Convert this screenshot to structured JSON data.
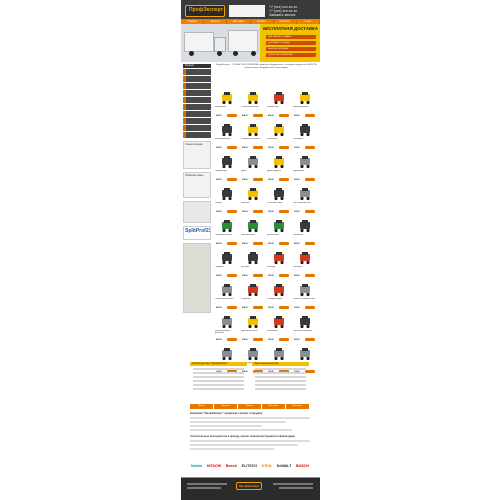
{
  "header": {
    "logo_text": "ПрофЭксперт",
    "phone_lines": [
      "+7 (xxx) xxx-xx-xx",
      "+7 (xxx) xxx-xx-xx",
      "Заказать звонок"
    ]
  },
  "nav": {
    "items": [
      "Главная",
      "Каталог",
      "Доставка",
      "Оплата",
      "Контакты",
      "О нас"
    ]
  },
  "hero": {
    "promo_title": "БЕСПЛАТНАЯ ДОСТАВКА",
    "promo_lines": [
      "при заказе от суммы",
      "доставка по городу",
      "быстрая отправка",
      "оплата при получении"
    ]
  },
  "sidebar": {
    "catalog_title": "Каталог",
    "banner_caption": "SplitProf23",
    "map_caption": "Схема проезда",
    "form_caption": "Обратная связь"
  },
  "intro": {
    "text": "\"ПрофЭксперт\" - ПРОКАТ ИНСТРУМЕНТА, продажа оборудования, электроинструмента и МНОГОЕ строительного оборудования в Краснодаре"
  },
  "products": [
    {
      "name": "Виброплита",
      "price": "500 ₽",
      "shape": "yellow-machine"
    },
    {
      "name": "Отбойный молоток",
      "price": "400 ₽",
      "shape": "yellow-machine"
    },
    {
      "name": "Компрессор",
      "price": "450 ₽",
      "shape": "red-machine"
    },
    {
      "name": "Вибротрамбовка",
      "price": "600 ₽",
      "shape": "yellow-machine"
    },
    {
      "name": "Бетономешалка",
      "price": "350 ₽",
      "shape": "dark-tool"
    },
    {
      "name": "Затирочная машина",
      "price": "500 ₽",
      "shape": "yellow-machine"
    },
    {
      "name": "Штроборез",
      "price": "300 ₽",
      "shape": "yellow-machine"
    },
    {
      "name": "Плиткорез",
      "price": "300 ₽",
      "shape": "dark-tool"
    },
    {
      "name": "Перфоратор",
      "price": "250 ₽",
      "shape": "dark-tool"
    },
    {
      "name": "Дрель",
      "price": "200 ₽",
      "shape": "gray-tool"
    },
    {
      "name": "Дрель ударная",
      "price": "200 ₽",
      "shape": "yellow-machine"
    },
    {
      "name": "Шуруповерт",
      "price": "200 ₽",
      "shape": "gray-tool"
    },
    {
      "name": "Лобзик",
      "price": "200 ₽",
      "shape": "dark-tool"
    },
    {
      "name": "Болгарка",
      "price": "250 ₽",
      "shape": "yellow-machine"
    },
    {
      "name": "Сабельная пила",
      "price": "250 ₽",
      "shape": "dark-tool"
    },
    {
      "name": "Фен строительный",
      "price": "150 ₽",
      "shape": "gray-tool"
    },
    {
      "name": "Торцовочная пила",
      "price": "400 ₽",
      "shape": "green-machine"
    },
    {
      "name": "Газонокосилка",
      "price": "500 ₽",
      "shape": "green-machine"
    },
    {
      "name": "Культиватор",
      "price": "600 ₽",
      "shape": "green-machine"
    },
    {
      "name": "Бензопила",
      "price": "450 ₽",
      "shape": "dark-tool"
    },
    {
      "name": "Триммер",
      "price": "350 ₽",
      "shape": "dark-tool"
    },
    {
      "name": "Кусторез",
      "price": "300 ₽",
      "shape": "dark-tool"
    },
    {
      "name": "Мотобур",
      "price": "500 ₽",
      "shape": "red-machine"
    },
    {
      "name": "Бензорез",
      "price": "600 ₽",
      "shape": "red-machine"
    },
    {
      "name": "Сварочный аппарат",
      "price": "400 ₽",
      "shape": "gray-tool"
    },
    {
      "name": "Генератор",
      "price": "800 ₽",
      "shape": "red-machine"
    },
    {
      "name": "Тепловая пушка",
      "price": "350 ₽",
      "shape": "red-machine"
    },
    {
      "name": "Пылесос строительный",
      "price": "300 ₽",
      "shape": "gray-tool"
    },
    {
      "name": "Мойка высокого давления",
      "price": "400 ₽",
      "shape": "gray-tool"
    },
    {
      "name": "Дренажный насос",
      "price": "300 ₽",
      "shape": "yellow-machine"
    },
    {
      "name": "Мотопомпа",
      "price": "500 ₽",
      "shape": "red-machine"
    },
    {
      "name": "Глубинный вибратор",
      "price": "350 ₽",
      "shape": "dark-tool"
    },
    {
      "name": "Леса строительные",
      "price": "100 ₽",
      "shape": "gray-tool"
    },
    {
      "name": "Вышка-тура",
      "price": "300 ₽",
      "shape": "gray-tool"
    },
    {
      "name": "Лестница",
      "price": "150 ₽",
      "shape": "gray-tool"
    },
    {
      "name": "Стремянка",
      "price": "100 ₽",
      "shape": "gray-tool"
    }
  ],
  "info": {
    "left_title": "Преимущества \"ПрофЭксперт\"",
    "right_title": "Наши преимущества"
  },
  "orange_links": [
    "Прокат",
    "Продажа",
    "Ремонт",
    "Доставка",
    "Контакты"
  ],
  "text_block": {
    "title1": "Компания \"ПрофЭксперт\" предлагает прокат и продажу",
    "title2": "Строительные инструменты в аренду, прокат электроинструмента в Краснодаре"
  },
  "brands": [
    {
      "name": "Makita",
      "color": "#1f9aa6"
    },
    {
      "name": "HITACHI",
      "color": "#d30000"
    },
    {
      "name": "Bosch",
      "color": "#d30000"
    },
    {
      "name": "ELITECH",
      "color": "#333333"
    },
    {
      "name": "STIHL",
      "color": "#f27600"
    },
    {
      "name": "DeWALT",
      "color": "#1a1a1a"
    },
    {
      "name": "BOSCH",
      "color": "#c40000"
    }
  ],
  "footer": {
    "logo_text": "ПрофЭксперт"
  },
  "colors": {
    "accent": "#e07a00",
    "dark": "#2b2b2b",
    "promo": "#f2c200"
  }
}
